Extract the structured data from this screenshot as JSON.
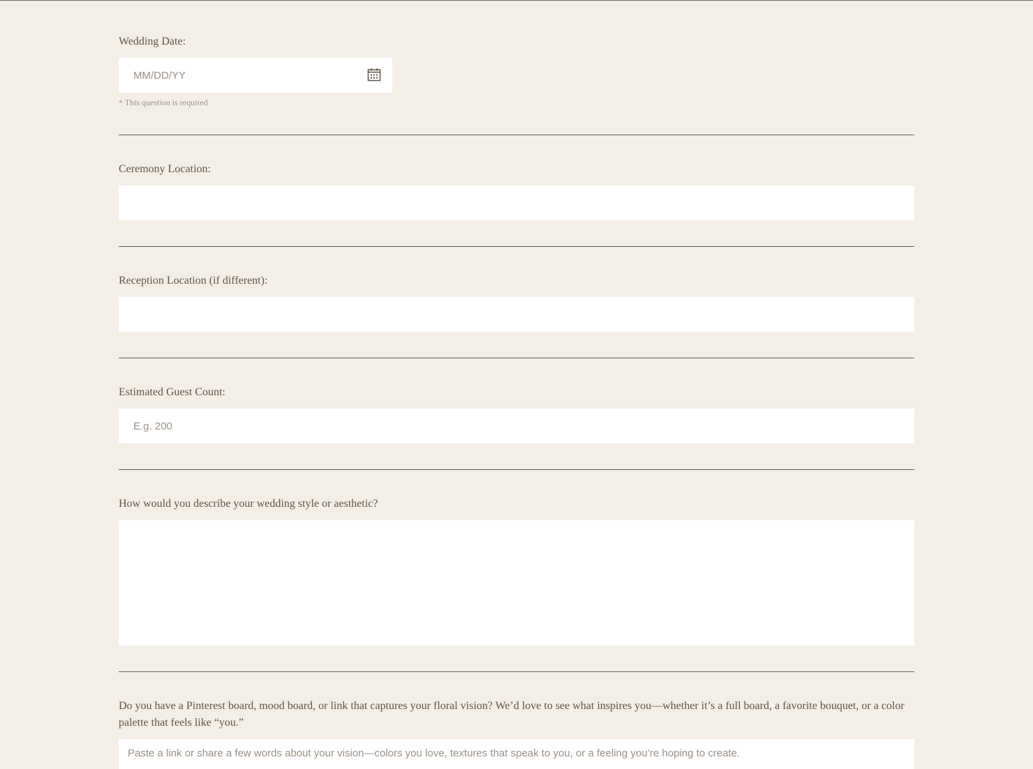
{
  "questions": {
    "wedding_date": {
      "label": "Wedding Date:",
      "placeholder": "MM/DD/YY",
      "required_note": "* This question is required"
    },
    "ceremony_location": {
      "label": "Ceremony Location:",
      "value": ""
    },
    "reception_location": {
      "label": "Reception Location (if different):",
      "value": ""
    },
    "guest_count": {
      "label": "Estimated Guest Count:",
      "placeholder": "E.g. 200"
    },
    "style": {
      "label": "How would you describe your wedding style or aesthetic?",
      "value": ""
    },
    "inspiration": {
      "label": "Do you have a Pinterest board, mood board, or link that captures your floral vision? We’d love to see what inspires you—whether it’s a full board, a favorite bouquet, or a color palette that feels like “you.”",
      "placeholder": "Paste a link or share a few words about your vision—colors you love, textures that speak to you, or a feeling you’re hoping to create."
    }
  },
  "icons": {
    "date_picker": "calendar-icon"
  },
  "colors": {
    "background": "#f3efe7",
    "text": "#5e5346",
    "placeholder": "#9a9087",
    "divider": "#5e6454",
    "field": "#ffffff"
  }
}
